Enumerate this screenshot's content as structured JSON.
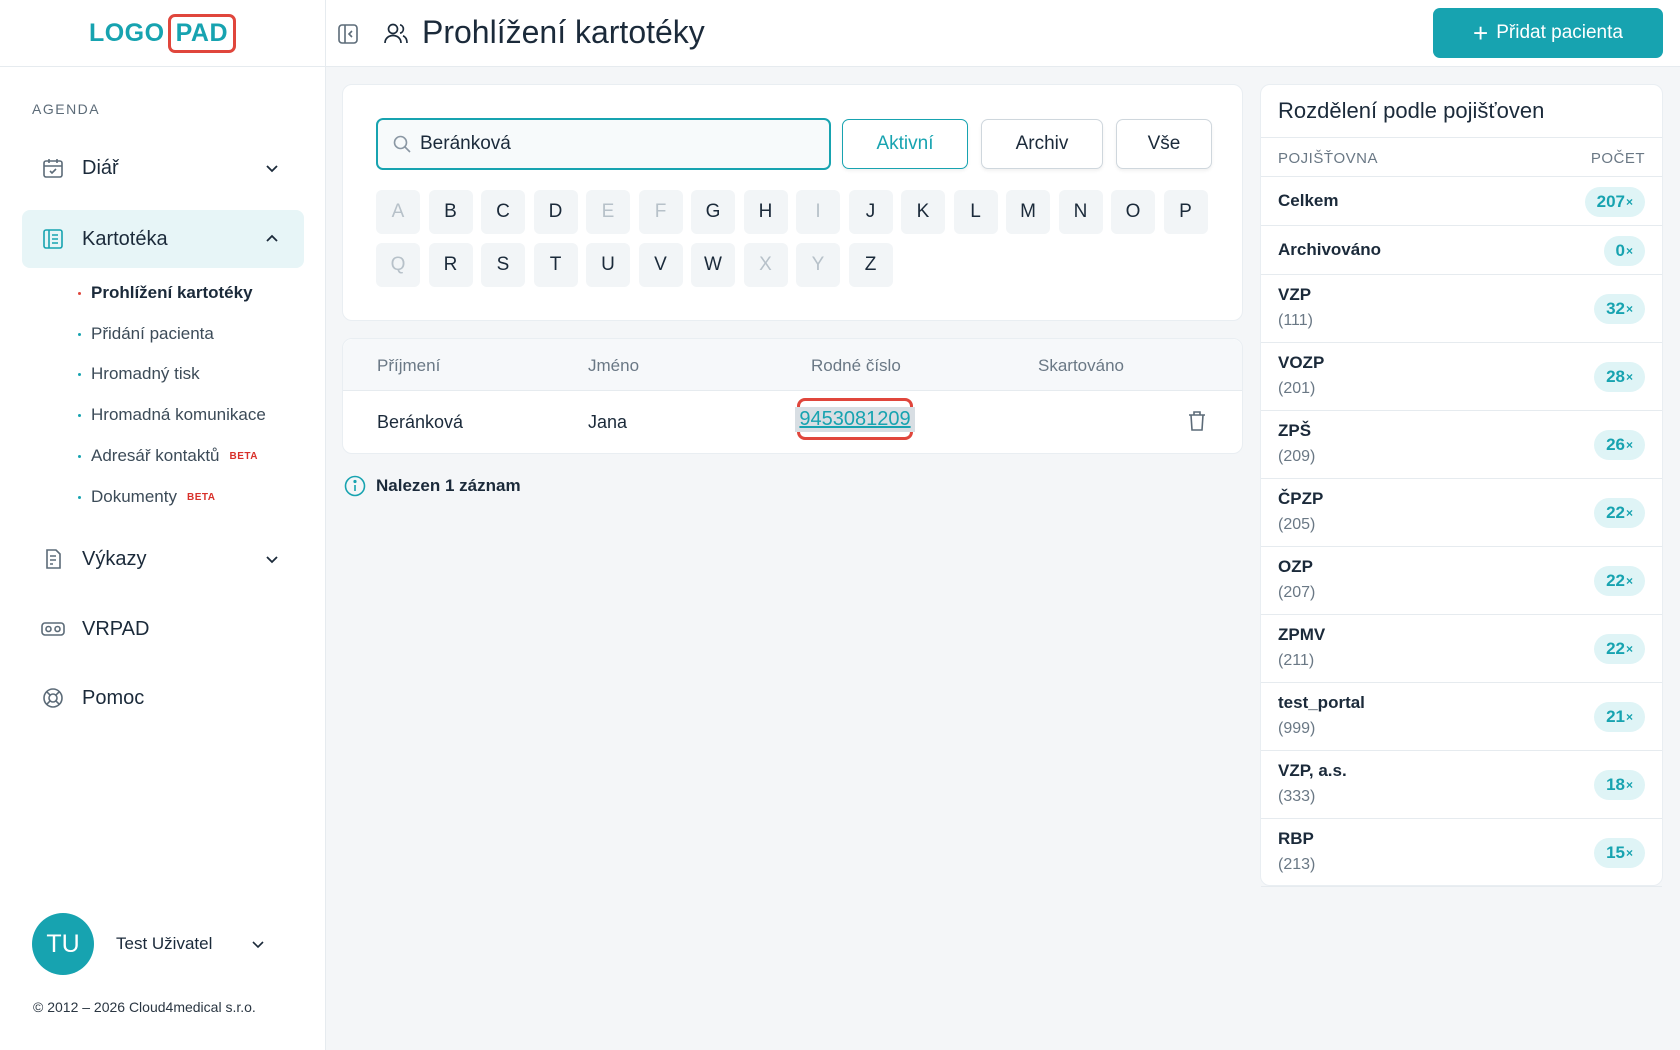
{
  "logo": {
    "left": "LOGO",
    "right": "PAD"
  },
  "sidebar": {
    "section_label": "AGENDA",
    "items": [
      {
        "label": "Diář"
      },
      {
        "label": "Kartotéka"
      },
      {
        "label": "Výkazy"
      },
      {
        "label": "VRPAD"
      },
      {
        "label": "Pomoc"
      }
    ],
    "subitems": [
      {
        "label": "Prohlížení kartotéky"
      },
      {
        "label": "Přidání pacienta"
      },
      {
        "label": "Hromadný tisk"
      },
      {
        "label": "Hromadná komunikace"
      },
      {
        "label": "Adresář kontaktů",
        "badge": "BETA"
      },
      {
        "label": "Dokumenty",
        "badge": "BETA"
      }
    ],
    "user": {
      "initials": "TU",
      "name": "Test Uživatel"
    },
    "copyright": "© 2012 – 2026 Cloud4medical s.r.o."
  },
  "header": {
    "title": "Prohlížení kartotéky",
    "add_button": "Přidat pacienta"
  },
  "search": {
    "value": "Beránková",
    "filters": [
      "Aktivní",
      "Archiv",
      "Vše"
    ],
    "active_filter": "Aktivní",
    "letters": [
      "A",
      "B",
      "C",
      "D",
      "E",
      "F",
      "G",
      "H",
      "I",
      "J",
      "K",
      "L",
      "M",
      "N",
      "O",
      "P",
      "Q",
      "R",
      "S",
      "T",
      "U",
      "V",
      "W",
      "X",
      "Y",
      "Z"
    ],
    "disabled_letters": [
      "A",
      "E",
      "F",
      "I",
      "Q",
      "X",
      "Y"
    ]
  },
  "table": {
    "columns": [
      "Příjmení",
      "Jméno",
      "Rodné číslo",
      "Skartováno"
    ],
    "rows": [
      {
        "surname": "Beránková",
        "name": "Jana",
        "rc": "9453081209",
        "shredded": ""
      }
    ],
    "found_text": "Nalezen 1 záznam"
  },
  "insurance": {
    "title": "Rozdělení podle pojišťoven",
    "col_name": "POJIŠŤOVNA",
    "col_count": "POČET",
    "rows": [
      {
        "name": "Celkem",
        "code": "",
        "count": "207",
        "suffix": "×"
      },
      {
        "name": "Archivováno",
        "code": "",
        "count": "0",
        "suffix": "×"
      },
      {
        "name": "VZP",
        "code": "(111)",
        "count": "32",
        "suffix": "×"
      },
      {
        "name": "VOZP",
        "code": "(201)",
        "count": "28",
        "suffix": "×"
      },
      {
        "name": "ZPŠ",
        "code": "(209)",
        "count": "26",
        "suffix": "×"
      },
      {
        "name": "ČPZP",
        "code": "(205)",
        "count": "22",
        "suffix": "×"
      },
      {
        "name": "OZP",
        "code": "(207)",
        "count": "22",
        "suffix": "×"
      },
      {
        "name": "ZPMV",
        "code": "(211)",
        "count": "22",
        "suffix": "×"
      },
      {
        "name": "test_portal",
        "code": "(999)",
        "count": "21",
        "suffix": "×"
      },
      {
        "name": "VZP, a.s.",
        "code": "(333)",
        "count": "18",
        "suffix": "×"
      },
      {
        "name": "RBP",
        "code": "(213)",
        "count": "15",
        "suffix": "×"
      }
    ]
  },
  "colors": {
    "accent": "#17a3b0",
    "highlight": "#e0463c"
  }
}
